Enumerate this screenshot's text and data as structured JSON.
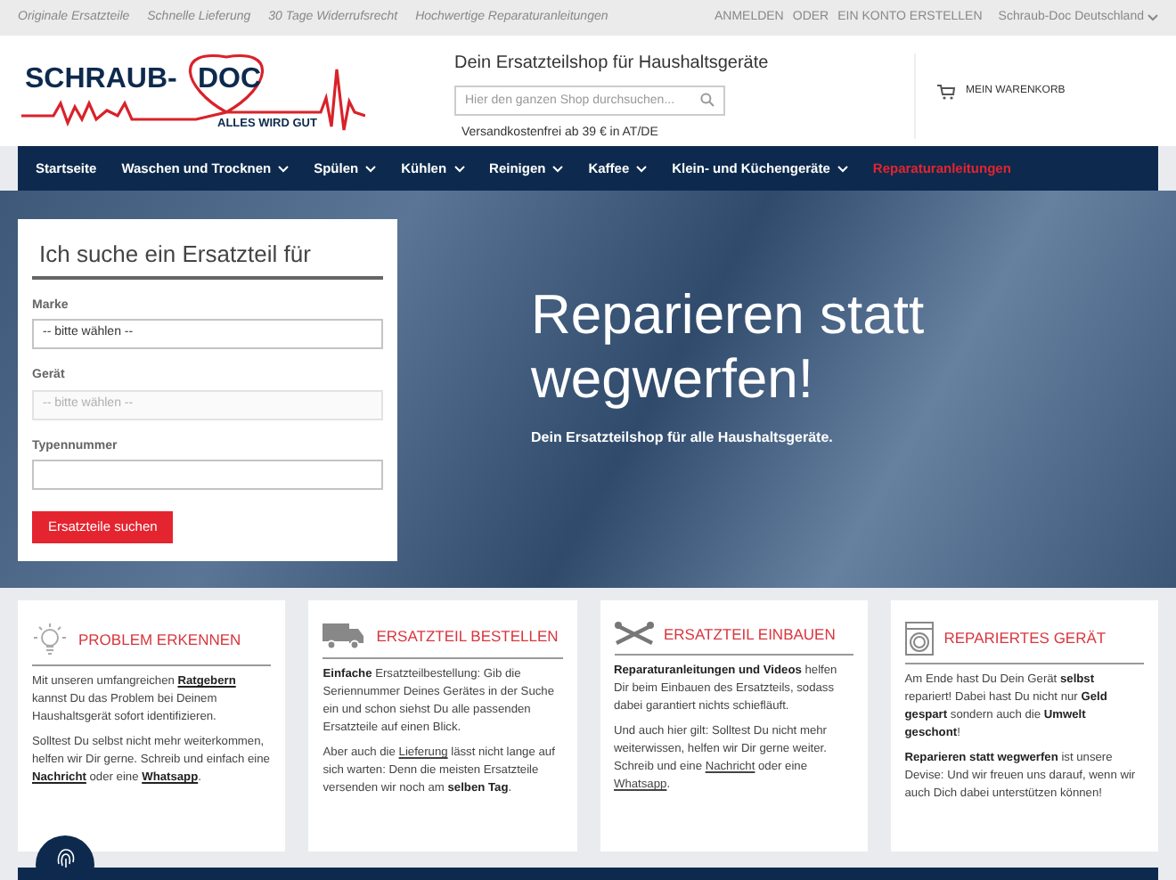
{
  "top_bar": {
    "usps": [
      "Originale Ersatzteile",
      "Schnelle Lieferung",
      "30 Tage Widerrufsrecht",
      "Hochwertige Reparaturanleitungen"
    ],
    "login": "ANMELDEN",
    "or": "ODER",
    "register": "EIN KONTO ERSTELLEN",
    "store": "Schraub-Doc Deutschland"
  },
  "header": {
    "logo": {
      "word_1": "SCHRAUB-",
      "word_2": "DOC",
      "tagline": "ALLES WIRD GUT"
    },
    "shop_title": "Dein Ersatzteilshop für Haushaltsgeräte",
    "search": {
      "placeholder": "Hier den ganzen Shop durchsuchen..."
    },
    "shipping_note": "Versandkostenfrei ab 39 € in AT/DE",
    "cart": "MEIN WARENKORB"
  },
  "nav": [
    {
      "label": "Startseite",
      "dropdown": false,
      "highlighted": false
    },
    {
      "label": "Waschen und Trocknen",
      "dropdown": true,
      "highlighted": false
    },
    {
      "label": "Spülen",
      "dropdown": true,
      "highlighted": false
    },
    {
      "label": "Kühlen",
      "dropdown": true,
      "highlighted": false
    },
    {
      "label": "Reinigen",
      "dropdown": true,
      "highlighted": false
    },
    {
      "label": "Kaffee",
      "dropdown": true,
      "highlighted": false
    },
    {
      "label": "Klein- und Küchengeräte",
      "dropdown": true,
      "highlighted": false
    },
    {
      "label": "Reparaturanleitungen",
      "dropdown": false,
      "highlighted": true
    }
  ],
  "search_form": {
    "title": "Ich suche ein Ersatzteil für",
    "fields": [
      {
        "label": "Marke",
        "value": "-- bitte wählen --",
        "disabled": false
      },
      {
        "label": "Gerät",
        "value": "-- bitte wählen --",
        "disabled": true
      },
      {
        "label": "Typennummer",
        "disabled": false
      }
    ],
    "button": "Ersatzteile suchen"
  },
  "hero": {
    "headline": "Reparieren statt wegwerfen!",
    "subline": "Dein Ersatzteilshop für alle Haushaltsgeräte."
  },
  "steps": [
    {
      "kind": "bulb",
      "title": "PROBLEM ERKENNEN",
      "paragraphs": [
        [
          {
            "kind": "text",
            "text": "Mit unseren umfangreichen "
          },
          {
            "kind": "bold_link",
            "text": "Ratgebern"
          },
          {
            "kind": "text",
            "text": " kannst Du das Problem bei Deinem Haushaltsgerät sofort identifizieren."
          }
        ],
        [
          {
            "kind": "text",
            "text": "Solltest Du selbst nicht mehr weiterkommen, helfen wir Dir gerne. Schreib und einfach eine "
          },
          {
            "kind": "bold_link",
            "text": "Nachricht"
          },
          {
            "kind": "text",
            "text": " oder eine "
          },
          {
            "kind": "bold_link",
            "text": "Whatsapp"
          },
          {
            "kind": "text",
            "text": "."
          }
        ]
      ]
    },
    {
      "kind": "truck",
      "title": "ERSATZTEIL BESTELLEN",
      "paragraphs": [
        [
          {
            "kind": "bold",
            "text": "Einfache"
          },
          {
            "kind": "text",
            "text": " Ersatzteilbestellung: Gib die Seriennummer Deines Gerätes in der Suche ein und schon siehst Du alle passenden Ersatzteile auf einen Blick."
          }
        ],
        [
          {
            "kind": "text",
            "text": "Aber auch die "
          },
          {
            "kind": "link",
            "text": "Lieferung"
          },
          {
            "kind": "text",
            "text": " lässt nicht lange auf sich warten: Denn die meisten Ersatzteile versenden wir noch am "
          },
          {
            "kind": "bold",
            "text": "selben Tag"
          },
          {
            "kind": "text",
            "text": "."
          }
        ]
      ]
    },
    {
      "kind": "tools",
      "title": "ERSATZTEIL EINBAUEN",
      "paragraphs": [
        [
          {
            "kind": "bold",
            "text": "Reparaturanleitungen und Videos"
          },
          {
            "kind": "text",
            "text": " helfen Dir beim Einbauen des Ersatzteils, sodass dabei garantiert nichts schiefläuft."
          }
        ],
        [
          {
            "kind": "text",
            "text": "Und auch hier gilt: Solltest Du nicht mehr weiterwissen, helfen wir Dir gerne weiter. Schreib und eine "
          },
          {
            "kind": "link",
            "text": "Nachricht"
          },
          {
            "kind": "text",
            "text": " oder eine "
          },
          {
            "kind": "link",
            "text": "Whatsapp"
          },
          {
            "kind": "text",
            "text": "."
          }
        ]
      ]
    },
    {
      "kind": "washer",
      "title": "REPARIERTES GERÄT",
      "paragraphs": [
        [
          {
            "kind": "text",
            "text": "Am Ende hast Du Dein Gerät "
          },
          {
            "kind": "bold",
            "text": "selbst"
          },
          {
            "kind": "text",
            "text": " repariert! Dabei hast Du nicht nur "
          },
          {
            "kind": "bold",
            "text": "Geld gespart"
          },
          {
            "kind": "text",
            "text": " sondern auch die "
          },
          {
            "kind": "bold",
            "text": "Umwelt geschont"
          },
          {
            "kind": "text",
            "text": "!"
          }
        ],
        [
          {
            "kind": "bold",
            "text": "Reparieren statt wegwerfen"
          },
          {
            "kind": "text",
            "text": " ist unsere Devise: Und wir freuen uns darauf, wenn wir auch Dich dabei unterstützen können!"
          }
        ]
      ]
    }
  ]
}
